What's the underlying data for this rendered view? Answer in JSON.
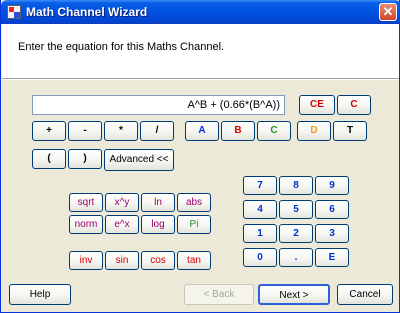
{
  "window": {
    "title": "Math Channel Wizard",
    "close_label": "✕"
  },
  "header": {
    "instruction": "Enter the equation for this Maths Channel."
  },
  "equation": {
    "value": "A^B + (0.66*(B^A))"
  },
  "buttons": {
    "ce": "CE",
    "c": "C",
    "plus": "+",
    "minus": "-",
    "multiply": "*",
    "divide": "/",
    "a": "A",
    "b": "B",
    "c_channel": "C",
    "d": "D",
    "t": "T",
    "open_paren": "(",
    "close_paren": ")",
    "advanced": "Advanced <<",
    "sqrt": "sqrt",
    "xpowy": "x^y",
    "ln": "ln",
    "abs": "abs",
    "norm": "norm",
    "epowx": "e^x",
    "log": "log",
    "pi": "Pi",
    "inv": "inv",
    "sin": "sin",
    "cos": "cos",
    "tan": "tan",
    "n7": "7",
    "n8": "8",
    "n9": "9",
    "n4": "4",
    "n5": "5",
    "n6": "6",
    "n1": "1",
    "n2": "2",
    "n3": "3",
    "n0": "0",
    "dot": ".",
    "e": "E"
  },
  "footer": {
    "help": "Help",
    "back": "< Back",
    "next": "Next >",
    "cancel": "Cancel"
  },
  "colors": {
    "title_bar": "#0054e3",
    "dialog_bg": "#ece9d8",
    "operator_red": "#d60000",
    "channel_blue": "#0033cc",
    "channel_green": "#239123",
    "channel_orange": "#e89a20",
    "function_purple": "#9a006e"
  }
}
